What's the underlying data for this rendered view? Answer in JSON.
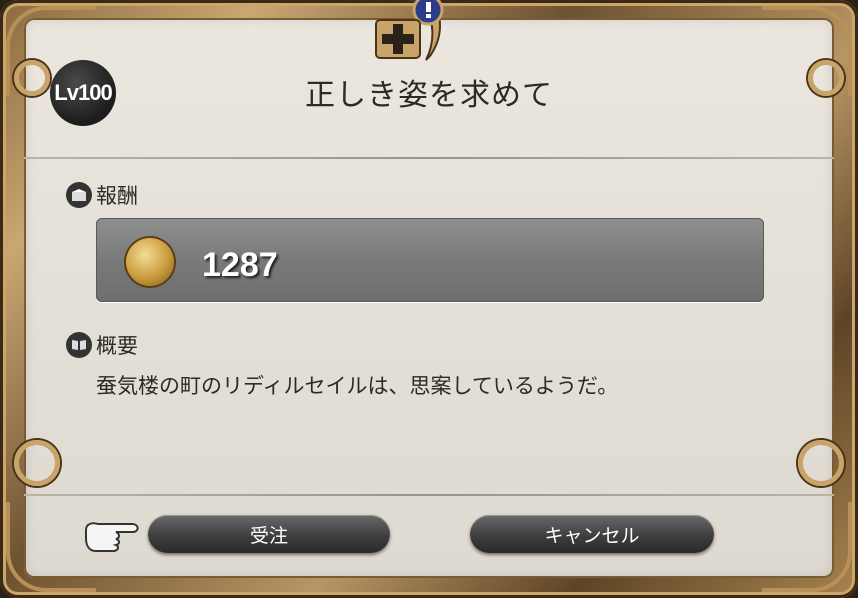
{
  "dialog": {
    "level_badge": "Lv100",
    "title": "正しき姿を求めて"
  },
  "reward": {
    "label": "報酬",
    "currency_icon": "gil-coin-icon",
    "amount": "1287"
  },
  "summary": {
    "label": "概要",
    "text": "蚕気楼の町のリディルセイルは、思案しているようだ。"
  },
  "buttons": {
    "accept": "受注",
    "cancel": "キャンセル"
  },
  "colors": {
    "frame_gold": "#b99158",
    "panel_bg": "#e8e4dc",
    "button_dark": "#3e3e3e",
    "reward_box": "#7a7a7a"
  }
}
